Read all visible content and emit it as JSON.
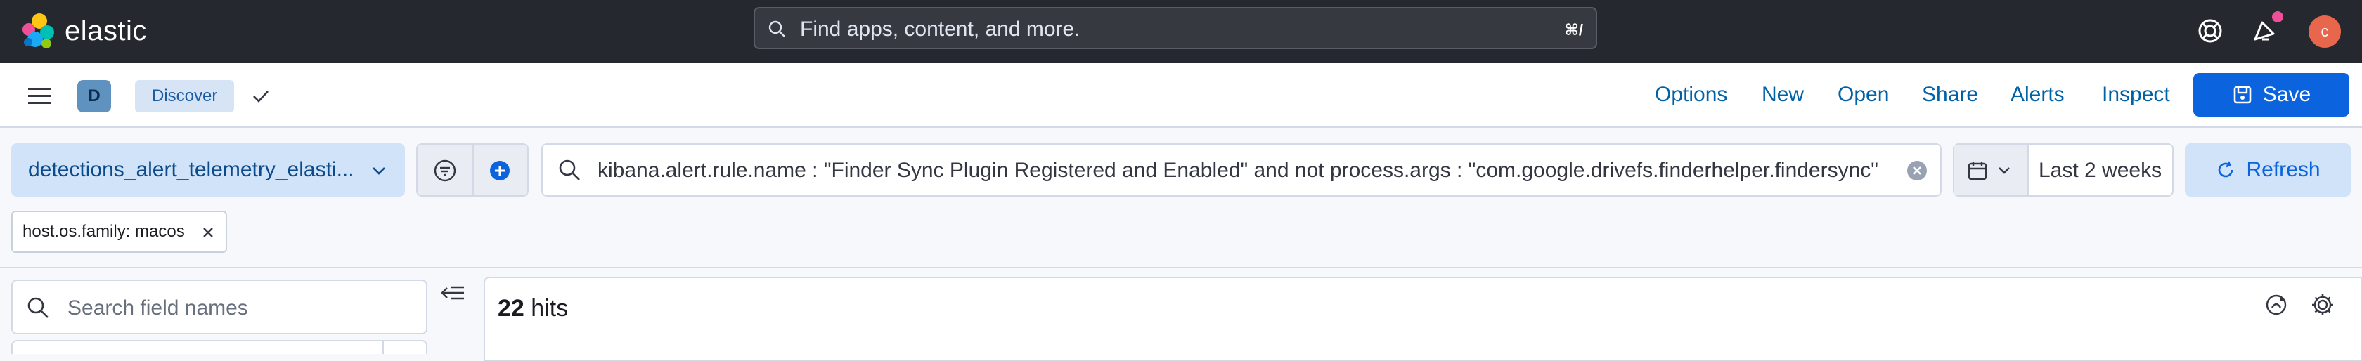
{
  "header": {
    "brand": "elastic",
    "search_placeholder": "Find apps, content, and more.",
    "search_shortcut": "⌘/",
    "avatar_initial": "c",
    "icons": [
      "help-icon",
      "news-feed-icon",
      "user-avatar"
    ]
  },
  "nav": {
    "space_initial": "D",
    "breadcrumb": "Discover",
    "menu": [
      "Options",
      "New",
      "Open",
      "Share",
      "Alerts",
      "Inspect"
    ],
    "save_label": "Save"
  },
  "query": {
    "data_view": "detections_alert_telemetry_elasti...",
    "text": "kibana.alert.rule.name : \"Finder Sync Plugin Registered and Enabled\" and not process.args : \"com.google.drivefs.finderhelper.findersync\"",
    "date_range": "Last 2 weeks",
    "refresh_label": "Refresh"
  },
  "filters": [
    {
      "label": "host.os.family: macos"
    }
  ],
  "sidebar": {
    "search_placeholder": "Search field names"
  },
  "results": {
    "hit_count": "22",
    "hit_label": "hits"
  },
  "colors": {
    "header_bg": "#25282f",
    "accent": "#0b64dd",
    "avatar": "#e7664c"
  }
}
